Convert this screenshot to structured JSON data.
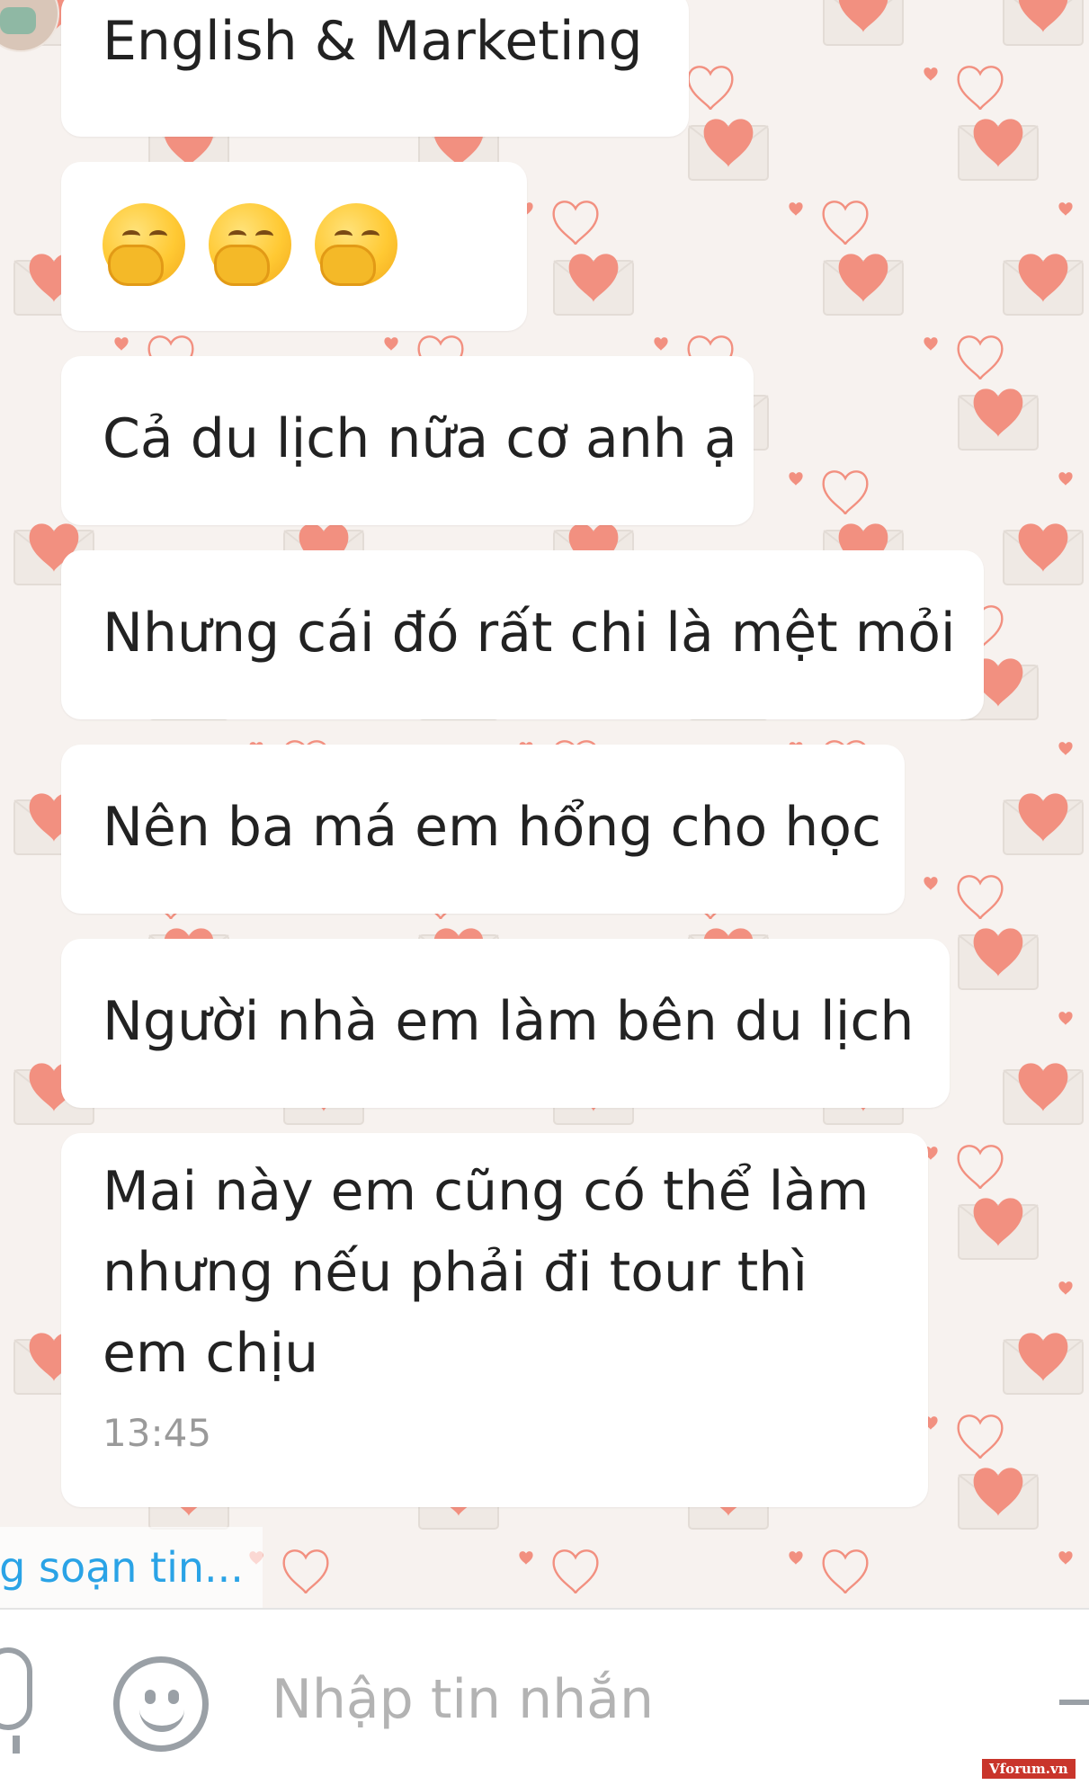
{
  "messages": [
    {
      "id": "b1",
      "text": "English & Marketing"
    },
    {
      "id": "b2",
      "emoji": [
        "face-with-hand-over-mouth",
        "face-with-hand-over-mouth",
        "face-with-hand-over-mouth"
      ]
    },
    {
      "id": "b3",
      "text": "Cả du lịch nữa cơ anh ạ"
    },
    {
      "id": "b4",
      "text": "Nhưng cái đó rất chi là mệt mỏi"
    },
    {
      "id": "b5",
      "text": "Nên ba má em hổng cho học"
    },
    {
      "id": "b6",
      "text": "Người nhà em làm bên du lịch"
    },
    {
      "id": "b7",
      "text": "Mai này em cũng có thể làm nhưng nếu phải đi tour thì em chịu",
      "time": "13:45"
    }
  ],
  "typing_indicator": "ng soạn tin...",
  "input": {
    "placeholder": "Nhập tin nhắn",
    "value": ""
  },
  "watermark": "Vforum.vn",
  "colors": {
    "accent": "#2aa3e6",
    "heart": "#f29080",
    "bubble": "#ffffff",
    "background": "#f7f2ef"
  }
}
